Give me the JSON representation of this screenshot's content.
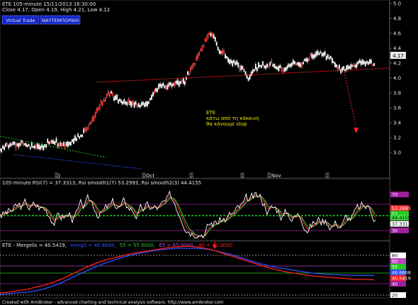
{
  "colors": {
    "background": "#000000",
    "price_up": "#ffffff",
    "price_down": "#ff3030",
    "resistance": "#ff2020",
    "rsi": "#ffffff",
    "rsi_smooth1": "#ff3030",
    "rsi_smooth2": "#40e040",
    "mergelis": "#ff2020",
    "mergelis2": "#3050ff",
    "level_green": "#22cc22",
    "level_purple": "#a020a0",
    "level_magenta": "#c040c0"
  },
  "header": {
    "line1": "ETE  105-minute  15/11/2013 16:30:00",
    "line2": "Close 4.17,  Open 4.19,  High 4.21,  Low 4.12",
    "btn_virtual": "Virtual Trade",
    "btn_naft": "ΝΑΥΤΕΜΠΟΡΙΚΗ"
  },
  "annotation": {
    "l1": "ETE",
    "l2": "κάτω από τη κόκκινη",
    "l3": "θα κάνουμε stop"
  },
  "price_axis": {
    "ticks": [
      "5.0",
      "4.8",
      "4.6",
      "4.4",
      "4.2",
      "4.0",
      "3.8",
      "3.6",
      "3.4",
      "3.2",
      "3.0"
    ],
    "last": "4.17"
  },
  "date_marks": [
    "J",
    "Oct",
    "",
    "",
    "Nov",
    ""
  ],
  "rsi_panel": {
    "title": "105-minute RSI(7) = 37.3313,  Rsi smooth1(7) 53.2993,  Rsi smooth2(3) 44.4155",
    "labels": [
      "70",
      "53.2993",
      "51",
      "44.4155",
      "37.3313",
      "30"
    ],
    "label_colors": [
      "#a020a0",
      "#ff3030",
      "#22cc22",
      "#40e040",
      "#ffffff",
      "#a020a0"
    ]
  },
  "mergelis_panel": {
    "title_a": "ETE - Mergelis = 40.5419,",
    "title_b": "merg2 = 46.6668,",
    "title_c": "55 = 55.0000,",
    "title_d": "65 = 65.0000,",
    "title_e": "40 = 40.0000",
    "labels": [
      "80",
      "65",
      "55",
      "46.6668",
      "40.5419",
      "40",
      "20"
    ],
    "label_colors": [
      "#ffffff",
      "#c040c0",
      "#22cc22",
      "#3050ff",
      "#ff2020",
      "#a020a0",
      "#ffffff"
    ]
  },
  "footer": "Created with AmiBroker - advanced charting and technical analysis software. http://www.amibroker.com",
  "chart_data": [
    {
      "type": "candlestick",
      "title": "ETE 105-minute",
      "ylim": [
        2.8,
        5.0
      ],
      "close_points": [
        [
          0,
          3.04
        ],
        [
          4,
          3.08
        ],
        [
          8,
          3.12
        ],
        [
          12,
          3.1
        ],
        [
          16,
          3.14
        ],
        [
          20,
          3.08
        ],
        [
          24,
          3.1
        ],
        [
          28,
          3.06
        ],
        [
          32,
          3.12
        ],
        [
          36,
          3.16
        ],
        [
          40,
          3.13
        ],
        [
          44,
          3.1
        ],
        [
          48,
          3.12
        ],
        [
          52,
          3.18
        ],
        [
          56,
          3.22
        ],
        [
          60,
          3.32
        ],
        [
          64,
          3.44
        ],
        [
          68,
          3.58
        ],
        [
          72,
          3.72
        ],
        [
          76,
          3.8
        ],
        [
          80,
          3.74
        ],
        [
          84,
          3.7
        ],
        [
          88,
          3.68
        ],
        [
          92,
          3.66
        ],
        [
          96,
          3.64
        ],
        [
          100,
          3.62
        ],
        [
          104,
          3.7
        ],
        [
          108,
          3.84
        ],
        [
          112,
          3.9
        ],
        [
          116,
          3.88
        ],
        [
          120,
          3.92
        ],
        [
          124,
          3.94
        ],
        [
          128,
          3.96
        ],
        [
          132,
          4.1
        ],
        [
          136,
          4.24
        ],
        [
          140,
          4.4
        ],
        [
          144,
          4.58
        ],
        [
          148,
          4.56
        ],
        [
          152,
          4.38
        ],
        [
          156,
          4.3
        ],
        [
          160,
          4.22
        ],
        [
          164,
          4.18
        ],
        [
          168,
          4.12
        ],
        [
          172,
          4.0
        ],
        [
          176,
          4.12
        ],
        [
          180,
          4.18
        ],
        [
          184,
          4.16
        ],
        [
          188,
          4.2
        ],
        [
          192,
          4.14
        ],
        [
          196,
          4.12
        ],
        [
          200,
          4.16
        ],
        [
          204,
          4.2
        ],
        [
          208,
          4.18
        ],
        [
          212,
          4.24
        ],
        [
          216,
          4.3
        ],
        [
          220,
          4.34
        ],
        [
          224,
          4.32
        ],
        [
          228,
          4.28
        ],
        [
          232,
          4.18
        ],
        [
          236,
          4.12
        ],
        [
          240,
          4.12
        ],
        [
          244,
          4.16
        ],
        [
          248,
          4.2
        ],
        [
          252,
          4.22
        ],
        [
          256,
          4.2
        ],
        [
          260,
          4.17
        ]
      ],
      "resistance_line": [
        [
          0,
          3.82
        ],
        [
          260,
          4.0
        ]
      ],
      "projection_arrow": [
        [
          240,
          4.0
        ],
        [
          250,
          3.2
        ]
      ]
    },
    {
      "type": "line",
      "title": "RSI(7)",
      "ylim": [
        20,
        80
      ],
      "levels": [
        70,
        51,
        30
      ],
      "series": [
        {
          "name": "RSI(7)",
          "last": 37.3313
        },
        {
          "name": "Rsi smooth1(7)",
          "last": 53.2993
        },
        {
          "name": "Rsi smooth2(3)",
          "last": 44.4155
        }
      ]
    },
    {
      "type": "line",
      "title": "ETE - Mergelis",
      "ylim": [
        15,
        85
      ],
      "levels": [
        80,
        65,
        55,
        40,
        20
      ],
      "series": [
        {
          "name": "Mergelis",
          "last": 40.5419,
          "values": [
            22,
            23,
            25,
            27,
            30,
            33,
            37,
            42,
            48,
            54,
            60,
            65,
            69,
            72,
            75,
            78,
            80,
            82,
            84,
            86,
            87,
            88,
            87,
            85,
            82,
            78,
            74,
            70,
            66,
            62,
            58,
            55,
            52,
            50,
            48,
            46,
            45,
            44,
            43,
            42,
            41,
            41,
            40.5419
          ]
        },
        {
          "name": "merg2",
          "last": 46.6668,
          "values": [
            20,
            21,
            22,
            23,
            25,
            28,
            32,
            37,
            43,
            49,
            55,
            60,
            65,
            69,
            73,
            76,
            79,
            81,
            83,
            84,
            85,
            85,
            85,
            84,
            82,
            79,
            76,
            72,
            68,
            64,
            61,
            58,
            56,
            54,
            52,
            50,
            49,
            48,
            47.5,
            47,
            46.8,
            46.7,
            46.6668
          ]
        }
      ]
    }
  ]
}
